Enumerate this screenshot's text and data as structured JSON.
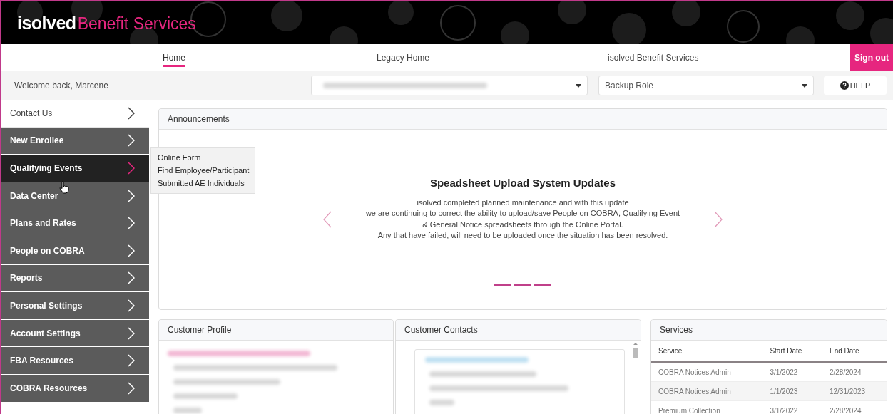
{
  "header": {
    "logo_mark": "isolved",
    "logo_text": "Benefit Services"
  },
  "nav_tabs": [
    {
      "label": "Home",
      "selected": true
    },
    {
      "label": "Legacy Home",
      "selected": false
    },
    {
      "label": "isolved Benefit Services",
      "selected": false
    }
  ],
  "sign_out": "Sign out",
  "welcome": "Welcome back, Marcene",
  "role_select": {
    "value": "Backup Role"
  },
  "help": "HELP",
  "sidebar": [
    {
      "label": "Contact Us",
      "kind": "plain",
      "hovered": false
    },
    {
      "label": "New Enrollee",
      "kind": "menu",
      "hovered": false
    },
    {
      "label": "Qualifying Events",
      "kind": "menu",
      "hovered": true
    },
    {
      "label": "Data Center",
      "kind": "menu",
      "hovered": false
    },
    {
      "label": "Plans and Rates",
      "kind": "menu",
      "hovered": false
    },
    {
      "label": "People on COBRA",
      "kind": "menu",
      "hovered": false
    },
    {
      "label": "Reports",
      "kind": "menu",
      "hovered": false
    },
    {
      "label": "Personal Settings",
      "kind": "menu",
      "hovered": false
    },
    {
      "label": "Account Settings",
      "kind": "menu",
      "hovered": false
    },
    {
      "label": "FBA Resources",
      "kind": "menu",
      "hovered": false
    },
    {
      "label": "COBRA Resources",
      "kind": "menu",
      "hovered": false
    }
  ],
  "flyout": [
    "Online Form",
    "Find Employee/Participant",
    "Submitted AE Individuals"
  ],
  "announcements": {
    "title": "Announcements",
    "headline": "Speadsheet Upload System Updates",
    "lines": [
      "isolved completed planned maintenance and with this update",
      "we are continuing to correct the ability to upload/save People on COBRA, Qualifying Event",
      "& General Notice spreadsheets through the Online Portal.",
      "Any that have failed, will need to be uploaded once the situation has been resolved."
    ]
  },
  "customer_profile": {
    "title": "Customer Profile"
  },
  "customer_contacts": {
    "title": "Customer Contacts"
  },
  "services": {
    "title": "Services",
    "columns": [
      "Service",
      "Start Date",
      "End Date"
    ],
    "rows": [
      [
        "COBRA Notices Admin",
        "3/1/2022",
        "2/28/2024"
      ],
      [
        "COBRA Notices Admin",
        "1/1/2023",
        "12/31/2023"
      ],
      [
        "Premium Collection",
        "3/1/2022",
        "2/28/2024"
      ]
    ]
  }
}
